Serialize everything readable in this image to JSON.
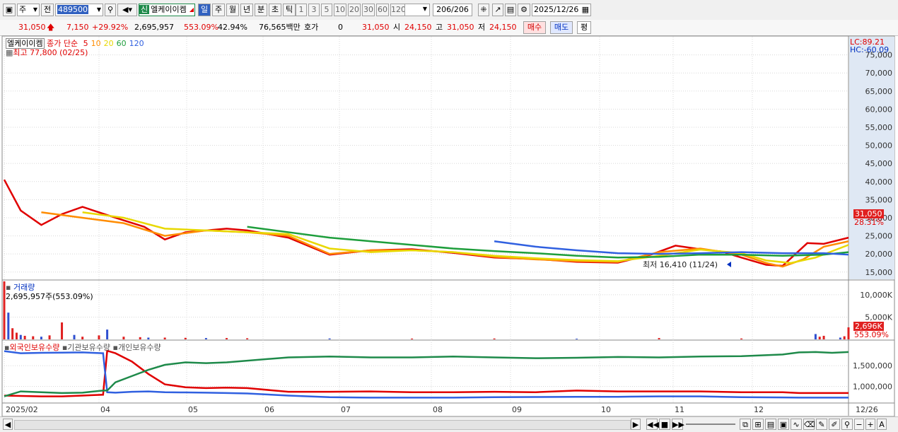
{
  "toolbar": {
    "period_type": "주",
    "scope": "전",
    "code": "489500",
    "credit_badge": "신",
    "stock_name": "엘케이이켐",
    "tabs": [
      "일",
      "주",
      "월",
      "년",
      "분",
      "초",
      "틱"
    ],
    "minute_options": [
      "1",
      "3",
      "5",
      "10",
      "20",
      "30",
      "60",
      "120"
    ],
    "count": "206/206",
    "date": "2025/12/26"
  },
  "quote": {
    "price": "31,050",
    "change": "7,150",
    "change_pct": "+29.92%",
    "volume": "2,695,957",
    "volume_pct": "553.09%",
    "turnover_pct": "42.94%",
    "amount": "76,565백만",
    "hoga_label": "호가",
    "hoga_value": "0",
    "hoga_price": "31,050",
    "open_label": "시",
    "open": "24,150",
    "high_label": "고",
    "high": "31,050",
    "low_label": "저",
    "low": "24,150",
    "buy_label": "매수",
    "sell_label": "매도",
    "eval_label": "평"
  },
  "price_panel": {
    "name": "엘케이이켐",
    "legend_prefix": "종가 단순",
    "ma_periods": [
      "5",
      "10",
      "20",
      "60",
      "120"
    ],
    "ma_colors": [
      "#e00000",
      "#ff8c00",
      "#e8d800",
      "#1e9e3c",
      "#3060e0"
    ],
    "high_note": "최고 77,800 (02/25)",
    "low_note": "최저 16,410 (11/24)",
    "lc": "LC:89.21",
    "hc": "HC:-60.09",
    "last_price_tag": "31,050",
    "last_pct_tag": "28.31%"
  },
  "volume_panel": {
    "title": "거래량",
    "detail": "2,695,957주(553.09%)",
    "last_tag": "2,696K",
    "last_pct": "553.09%"
  },
  "holdings_panel": {
    "series_names": [
      "외국인보유수량",
      "기관보유수량",
      "개인보유수량"
    ],
    "series_colors": [
      "#e00000",
      "#3060e0",
      "#1e8a4a"
    ]
  },
  "x_axis": {
    "labels": [
      "2025/02",
      "04",
      "05",
      "06",
      "07",
      "08",
      "09",
      "10",
      "11",
      "12"
    ],
    "last_label": "12/26"
  },
  "chart_data": [
    {
      "type": "line",
      "title": "엘케이이켐",
      "ylim": [
        13000,
        80000
      ],
      "yticks": [
        "15,000",
        "20,000",
        "25,000",
        "30,000",
        "35,000",
        "40,000",
        "45,000",
        "50,000",
        "55,000",
        "60,000",
        "65,000",
        "70,000",
        "75,000"
      ],
      "ytick_values": [
        15000,
        20000,
        25000,
        30000,
        35000,
        40000,
        45000,
        50000,
        55000,
        60000,
        65000,
        70000,
        75000
      ],
      "series": [
        {
          "name": "5",
          "x": [
            1,
            5,
            10,
            15,
            20,
            28,
            35,
            40,
            45,
            55,
            60,
            70,
            80,
            90,
            100,
            110,
            120,
            130,
            140,
            150,
            158,
            164,
            170,
            175,
            180,
            186,
            190,
            196,
            200,
            206
          ],
          "values": [
            40500,
            32000,
            28000,
            31000,
            33000,
            30000,
            27500,
            24000,
            26000,
            27000,
            26500,
            24500,
            19800,
            21000,
            21300,
            20300,
            19000,
            18600,
            17800,
            17600,
            19800,
            22300,
            21300,
            20700,
            19000,
            17000,
            16700,
            23000,
            22800,
            24500
          ]
        },
        {
          "name": "10",
          "x": [
            10,
            20,
            30,
            40,
            50,
            60,
            70,
            80,
            90,
            100,
            110,
            120,
            130,
            140,
            150,
            160,
            170,
            180,
            186,
            190,
            195,
            200,
            206
          ],
          "values": [
            31500,
            30000,
            28500,
            25000,
            26500,
            26000,
            25000,
            20000,
            21000,
            21000,
            20500,
            19200,
            18500,
            18000,
            17800,
            20500,
            21500,
            19800,
            17500,
            16500,
            18500,
            22000,
            23500
          ]
        },
        {
          "name": "20",
          "x": [
            20,
            30,
            40,
            50,
            60,
            70,
            80,
            90,
            100,
            110,
            120,
            130,
            140,
            150,
            160,
            170,
            180,
            186,
            192,
            198,
            206
          ],
          "values": [
            31500,
            30000,
            27000,
            26500,
            26000,
            25500,
            21500,
            20500,
            21000,
            20500,
            19500,
            18800,
            18300,
            18000,
            19500,
            21200,
            20200,
            18200,
            17500,
            19000,
            22500
          ]
        },
        {
          "name": "60",
          "x": [
            60,
            70,
            80,
            90,
            100,
            110,
            120,
            130,
            140,
            150,
            160,
            170,
            180,
            190,
            200,
            206
          ],
          "values": [
            27500,
            26000,
            24500,
            23500,
            22500,
            21500,
            20800,
            20200,
            19500,
            19000,
            19200,
            19800,
            19800,
            19500,
            19800,
            20500
          ]
        },
        {
          "name": "120",
          "x": [
            120,
            130,
            140,
            150,
            160,
            170,
            180,
            190,
            200,
            206
          ],
          "values": [
            23500,
            22000,
            21000,
            20200,
            20000,
            20200,
            20500,
            20200,
            20200,
            19800
          ]
        }
      ]
    },
    {
      "type": "bar",
      "title": "거래량",
      "ylim": [
        0,
        13000000
      ],
      "yticks": [
        "5,000K",
        "10,000K"
      ],
      "ytick_values": [
        5000000,
        10000000
      ],
      "x": [
        1,
        2,
        3,
        4,
        5,
        6,
        8,
        10,
        12,
        15,
        18,
        20,
        24,
        26,
        30,
        34,
        36,
        40,
        45,
        50,
        55,
        60,
        80,
        100,
        120,
        140,
        160,
        180,
        198,
        199,
        200,
        204,
        205,
        206
      ],
      "values": [
        13000000,
        6000000,
        2500000,
        1500000,
        1000000,
        800000,
        700000,
        600000,
        900000,
        3800000,
        1000000,
        600000,
        900000,
        2200000,
        600000,
        500000,
        400000,
        400000,
        350000,
        300000,
        300000,
        250000,
        200000,
        180000,
        200000,
        150000,
        300000,
        200000,
        1200000,
        600000,
        800000,
        400000,
        700000,
        2696000
      ]
    },
    {
      "type": "line",
      "title": "보유수량",
      "ylim": [
        600000,
        2100000
      ],
      "yticks": [
        "1,000,000",
        "1,500,000"
      ],
      "ytick_values": [
        1000000,
        1500000
      ],
      "x": [
        1,
        5,
        10,
        15,
        20,
        25,
        26,
        28,
        32,
        36,
        40,
        45,
        50,
        55,
        60,
        70,
        80,
        90,
        100,
        110,
        120,
        130,
        140,
        150,
        160,
        170,
        180,
        190,
        194,
        198,
        202,
        206
      ],
      "series": [
        {
          "name": "외국인보유수량",
          "values": [
            780000,
            770000,
            760000,
            760000,
            780000,
            800000,
            1860000,
            1800000,
            1600000,
            1300000,
            1050000,
            980000,
            960000,
            970000,
            960000,
            870000,
            870000,
            880000,
            860000,
            860000,
            870000,
            860000,
            900000,
            880000,
            880000,
            880000,
            860000,
            860000,
            840000,
            840000,
            840000,
            840000
          ]
        },
        {
          "name": "기관보유수량",
          "values": [
            1850000,
            1800000,
            1810000,
            1815000,
            1820000,
            1800000,
            860000,
            850000,
            870000,
            880000,
            860000,
            855000,
            850000,
            840000,
            830000,
            780000,
            740000,
            730000,
            730000,
            730000,
            740000,
            745000,
            750000,
            750000,
            760000,
            760000,
            740000,
            735000,
            730000,
            730000,
            730000,
            730000
          ]
        },
        {
          "name": "개인보유수량",
          "values": [
            760000,
            880000,
            860000,
            840000,
            850000,
            900000,
            900000,
            1100000,
            1250000,
            1400000,
            1520000,
            1580000,
            1560000,
            1580000,
            1620000,
            1700000,
            1720000,
            1700000,
            1700000,
            1720000,
            1700000,
            1680000,
            1690000,
            1710000,
            1700000,
            1720000,
            1730000,
            1770000,
            1820000,
            1830000,
            1810000,
            1830000
          ]
        }
      ]
    }
  ]
}
